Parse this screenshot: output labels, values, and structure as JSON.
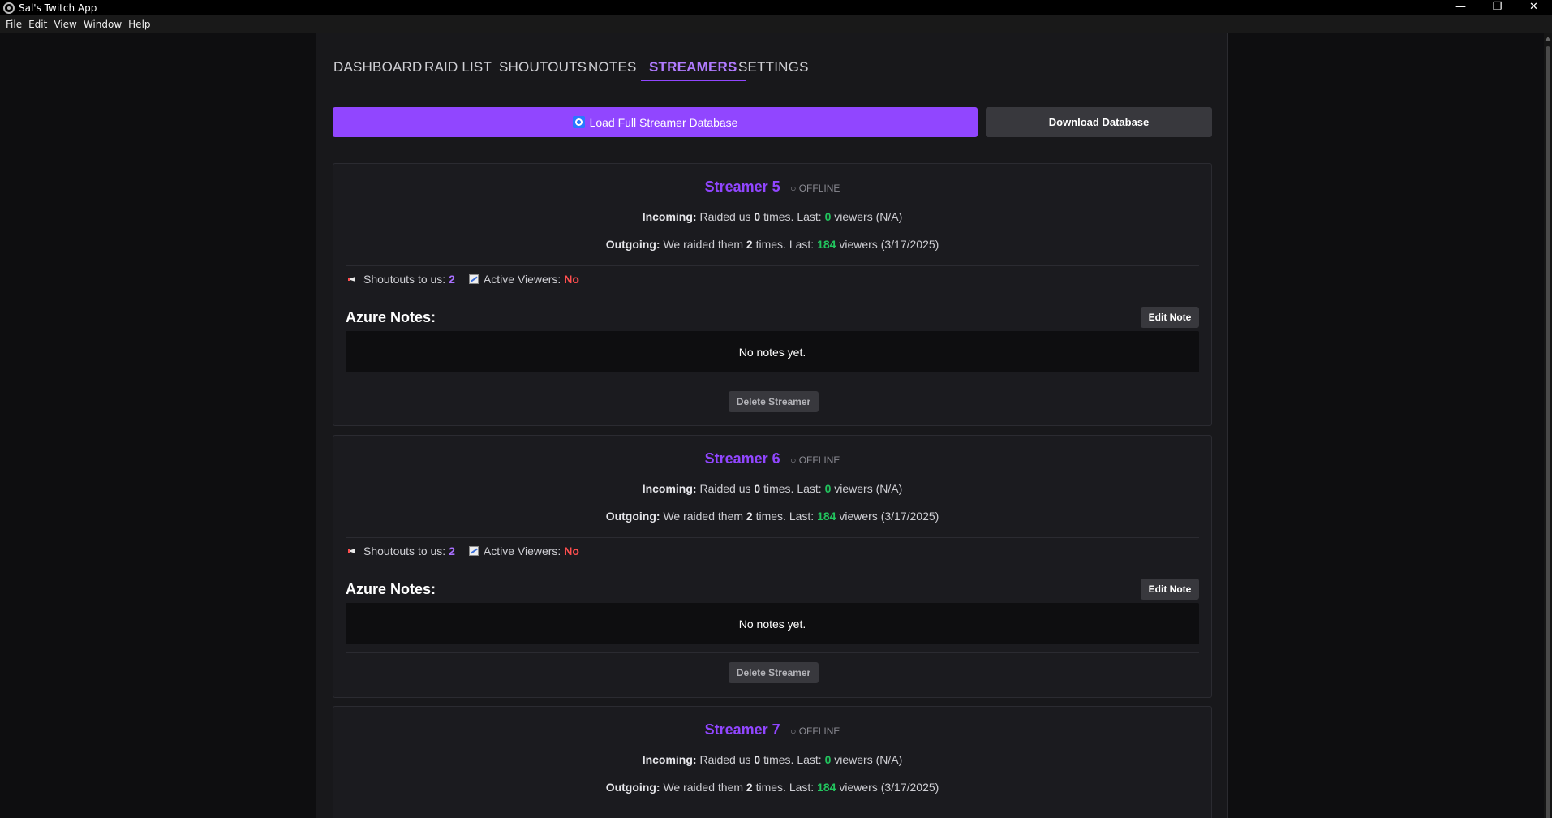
{
  "window": {
    "title": "Sal's Twitch App",
    "minimize": "—",
    "restore": "❐",
    "close": "✕"
  },
  "menu": [
    "File",
    "Edit",
    "View",
    "Window",
    "Help"
  ],
  "tabs": [
    "DASHBOARD",
    "RAID LIST",
    "SHOUTOUTS",
    "NOTES",
    "STREAMERS",
    "SETTINGS"
  ],
  "active_tab": "STREAMERS",
  "buttons": {
    "load_db": "Load Full Streamer Database",
    "download_db": "Download Database"
  },
  "labels": {
    "incoming": "Incoming:",
    "outgoing": "Outgoing:",
    "raided_us": "Raided us",
    "we_raided": "We raided them",
    "times_last": "times. Last:",
    "viewers": "viewers",
    "shoutouts": "Shoutouts to us:",
    "active_viewers": "Active Viewers:",
    "notes_title": "Azure Notes:",
    "edit_note": "Edit Note",
    "delete": "Delete Streamer"
  },
  "streamers": [
    {
      "name": "Streamer 5",
      "status": "○ OFFLINE",
      "incoming_count": "0",
      "incoming_viewers": "0",
      "incoming_date": "(N/A)",
      "outgoing_count": "2",
      "outgoing_viewers": "184",
      "outgoing_date": "(3/17/2025)",
      "shoutouts": "2",
      "active": "No",
      "notes": "No notes yet."
    },
    {
      "name": "Streamer 6",
      "status": "○ OFFLINE",
      "incoming_count": "0",
      "incoming_viewers": "0",
      "incoming_date": "(N/A)",
      "outgoing_count": "2",
      "outgoing_viewers": "184",
      "outgoing_date": "(3/17/2025)",
      "shoutouts": "2",
      "active": "No",
      "notes": "No notes yet."
    },
    {
      "name": "Streamer 7",
      "status": "○ OFFLINE",
      "incoming_count": "0",
      "incoming_viewers": "0",
      "incoming_date": "(N/A)",
      "outgoing_count": "2",
      "outgoing_viewers": "184",
      "outgoing_date": "(3/17/2025)"
    }
  ],
  "colors": {
    "accent": "#9146ff",
    "positive": "#22c55e",
    "negative": "#ff4f4f"
  }
}
